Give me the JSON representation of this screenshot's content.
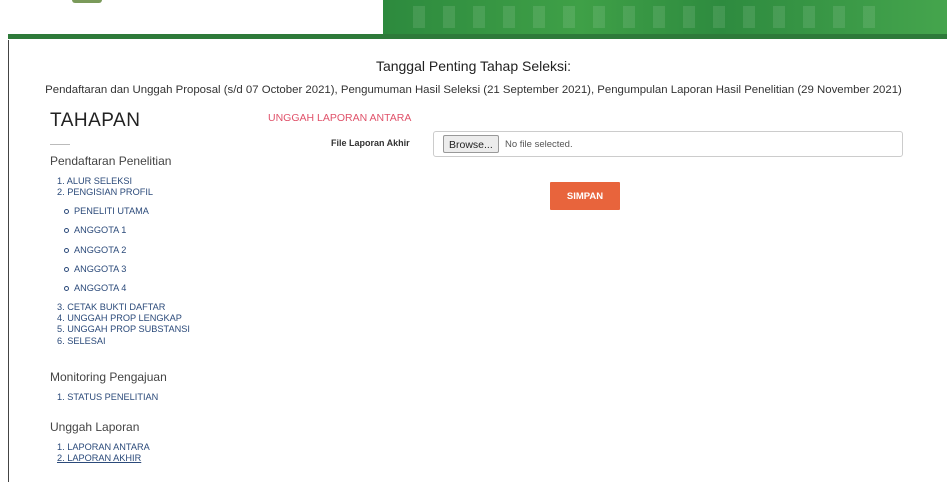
{
  "important": {
    "title": "Tanggal Penting Tahap Seleksi:",
    "dates": "Pendaftaran dan Unggah Proposal (s/d 07 October 2021), Pengumuman Hasil Seleksi (21 September 2021), Pengumpulan Laporan Hasil Penelitian (29 November 2021)"
  },
  "sidebar": {
    "heading": "TAHAPAN",
    "pendaftaran": {
      "title": "Pendaftaran Penelitian",
      "steps_a": [
        "1. ALUR SELEKSI",
        "2. PENGISIAN PROFIL"
      ],
      "sub": [
        "PENELITI UTAMA",
        "ANGGOTA 1",
        "ANGGOTA 2",
        "ANGGOTA 3",
        "ANGGOTA 4"
      ],
      "steps_b": [
        "3. CETAK BUKTI DAFTAR",
        "4. UNGGAH PROP LENGKAP",
        "5. UNGGAH PROP SUBSTANSI",
        "6. SELESAI"
      ]
    },
    "monitoring": {
      "title": "Monitoring Pengajuan",
      "steps": [
        "1. STATUS PENELITIAN"
      ]
    },
    "unggah": {
      "title": "Unggah Laporan",
      "steps": [
        "1. LAPORAN ANTARA",
        "2. LAPORAN AKHIR"
      ]
    }
  },
  "form": {
    "title": "UNGGAH LAPORAN ANTARA",
    "file_label": "File Laporan Akhir",
    "browse_label": "Browse...",
    "file_status": "No file selected.",
    "save_label": "SIMPAN"
  },
  "colors": {
    "header_green": "#3fa047",
    "header_bar": "#2e7a3a",
    "form_title": "#e0526a",
    "save_button": "#e8643c",
    "link": "#2b4a7a"
  }
}
